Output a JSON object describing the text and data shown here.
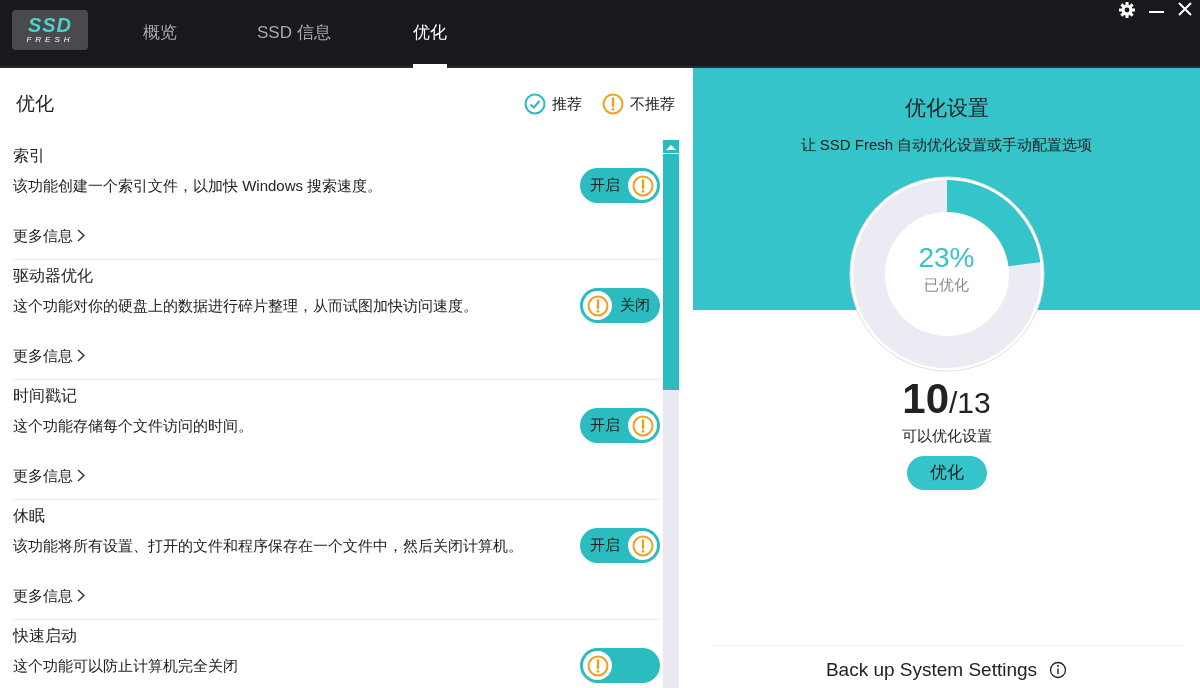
{
  "app": {
    "logo_top": "SSD",
    "logo_bottom": "FRESH"
  },
  "tabs": [
    {
      "label": "概览",
      "selected": false
    },
    {
      "label": "SSD 信息",
      "selected": false
    },
    {
      "label": "优化",
      "selected": true
    }
  ],
  "optimization": {
    "title": "优化",
    "legend": [
      {
        "kind": "check",
        "label": "推荐"
      },
      {
        "kind": "warn",
        "label": "不推荐"
      }
    ],
    "items": [
      {
        "title": "索引",
        "description": "该功能创建一个索引文件，以加快 Windows 搜索速度。",
        "toggle": {
          "label": "开启",
          "on": true
        },
        "more": "更多信息"
      },
      {
        "title": "驱动器优化",
        "description": "这个功能对你的硬盘上的数据进行碎片整理，从而试图加快访问速度。",
        "toggle": {
          "label": "关闭",
          "on": false
        },
        "more": "更多信息"
      },
      {
        "title": "时间戳记",
        "description": "这个功能存储每个文件访问的时间。",
        "toggle": {
          "label": "开启",
          "on": true
        },
        "more": "更多信息"
      },
      {
        "title": "休眠",
        "description": "该功能将所有设置、打开的文件和程序保存在一个文件中，然后关闭计算机。",
        "toggle": {
          "label": "开启",
          "on": true
        },
        "more": "更多信息"
      },
      {
        "title": "快速启动",
        "description": "这个功能可以防止计算机完全关闭",
        "toggle": {
          "on": false
        }
      }
    ]
  },
  "settings": {
    "title": "优化设置",
    "subtitle": "让 SSD Fresh 自动优化设置或手动配置选项",
    "progress": {
      "reading": "23%",
      "caption": "已优化"
    },
    "count": "10",
    "total": "/13",
    "count_caption": "可以优化设置",
    "button": "优化",
    "backup_title": "Back up System Settings"
  }
}
